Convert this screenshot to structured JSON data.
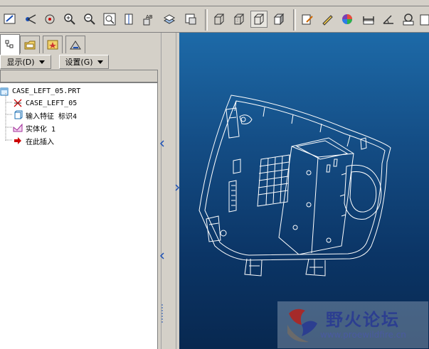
{
  "tree": {
    "root": "CASE_LEFT_05.PRT",
    "items": [
      {
        "label": "CASE_LEFT_05",
        "icon": "csys-icon"
      },
      {
        "label": "输入特征 标识4",
        "icon": "import-feature-icon"
      },
      {
        "label": "实体化 1",
        "icon": "solidify-icon"
      },
      {
        "label": "在此插入",
        "icon": "insert-here-arrow-icon"
      }
    ]
  },
  "menus": {
    "show": "显示(D)",
    "settings": "设置(G)"
  },
  "watermark": {
    "title": "野火论坛",
    "url": "www.proewildfire.cn"
  },
  "colors": {
    "viewport_top": "#1d6aa8",
    "viewport_bottom": "#082850",
    "model_lines": "#ffffff"
  }
}
